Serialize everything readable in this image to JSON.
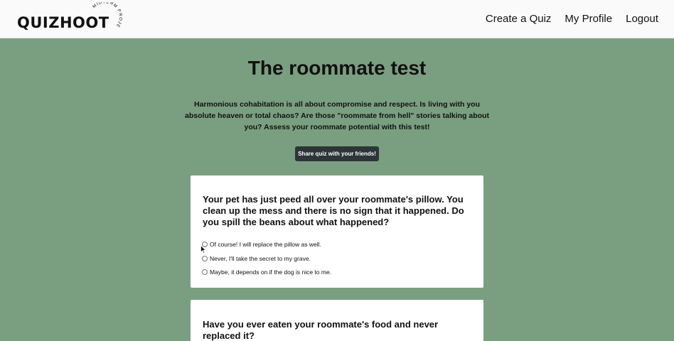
{
  "nav": {
    "logo_text": "QUIZHOOT",
    "logo_badge": "MIDTERM PROJECT",
    "links": [
      "Create a Quiz",
      "My Profile",
      "Logout"
    ]
  },
  "quiz": {
    "title": "The roommate test",
    "description": "Harmonious cohabitation is all about compromise and respect. Is living with you absolute heaven or total chaos? Are those \"roommate from hell\" stories talking about you? Assess your roommate potential with this test!",
    "share_label": "Share quiz with your friends!"
  },
  "questions": [
    {
      "text": "Your pet has just peed all over your roommate's pillow. You clean up the mess and there is no sign that it happened. Do you spill the beans about what happened?",
      "options": [
        "Of course! I will replace the pillow as well.",
        "Never, I'll take the secret to my grave.",
        "Maybe, it depends on if the dog is nice to me."
      ]
    },
    {
      "text": "Have you ever eaten your roommate's food and never replaced it?"
    }
  ],
  "colors": {
    "background": "#7a9f80",
    "button": "#2d3538",
    "card": "#ffffff"
  },
  "icons": {
    "cursor": "mouse-pointer-icon"
  }
}
